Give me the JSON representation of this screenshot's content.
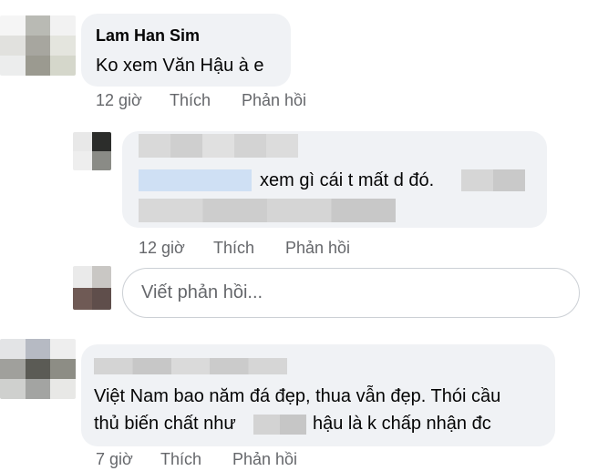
{
  "comments": [
    {
      "author": "Lam Han Sim",
      "text": "Ko xem Văn Hậu à e",
      "time": "12 giờ",
      "like_label": "Thích",
      "reply_label": "Phản hồi"
    },
    {
      "author": "",
      "text_visible": "xem gì cái t mất d đó.",
      "time": "12 giờ",
      "like_label": "Thích",
      "reply_label": "Phản hồi"
    },
    {
      "author": "",
      "text_line1": "Việt Nam bao năm đá đẹp, thua vẫn đẹp. Thói cầu",
      "text_line2_a": "thủ biến chất như",
      "text_line2_b": "hậu là k chấp nhận đc",
      "time": "7 giờ",
      "like_label": "Thích",
      "reply_label": "Phản hồi"
    }
  ],
  "reply_box": {
    "placeholder": "Viết phản hồi..."
  }
}
